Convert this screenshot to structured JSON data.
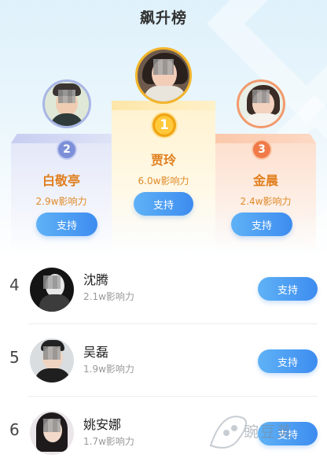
{
  "title": "飙升榜",
  "support_label": "支持",
  "podium": [
    {
      "rank": "2",
      "name": "白敬亭",
      "influence": "2.9w影响力"
    },
    {
      "rank": "1",
      "name": "贾玲",
      "influence": "6.0w影响力"
    },
    {
      "rank": "3",
      "name": "金晨",
      "influence": "2.4w影响力"
    }
  ],
  "list": [
    {
      "rank": "4",
      "name": "沈腾",
      "influence": "2.1w影响力"
    },
    {
      "rank": "5",
      "name": "吴磊",
      "influence": "1.9w影响力"
    },
    {
      "rank": "6",
      "name": "姚安娜",
      "influence": "1.7w影响力"
    }
  ],
  "watermark": {
    "text": "豌豆荚"
  },
  "colors": {
    "accent_blue": "#3d8cf0",
    "gold_text": "#e07e1d",
    "silver_medal": "#7d8fd8",
    "gold_medal": "#f5b021",
    "bronze_medal": "#f07a48"
  }
}
